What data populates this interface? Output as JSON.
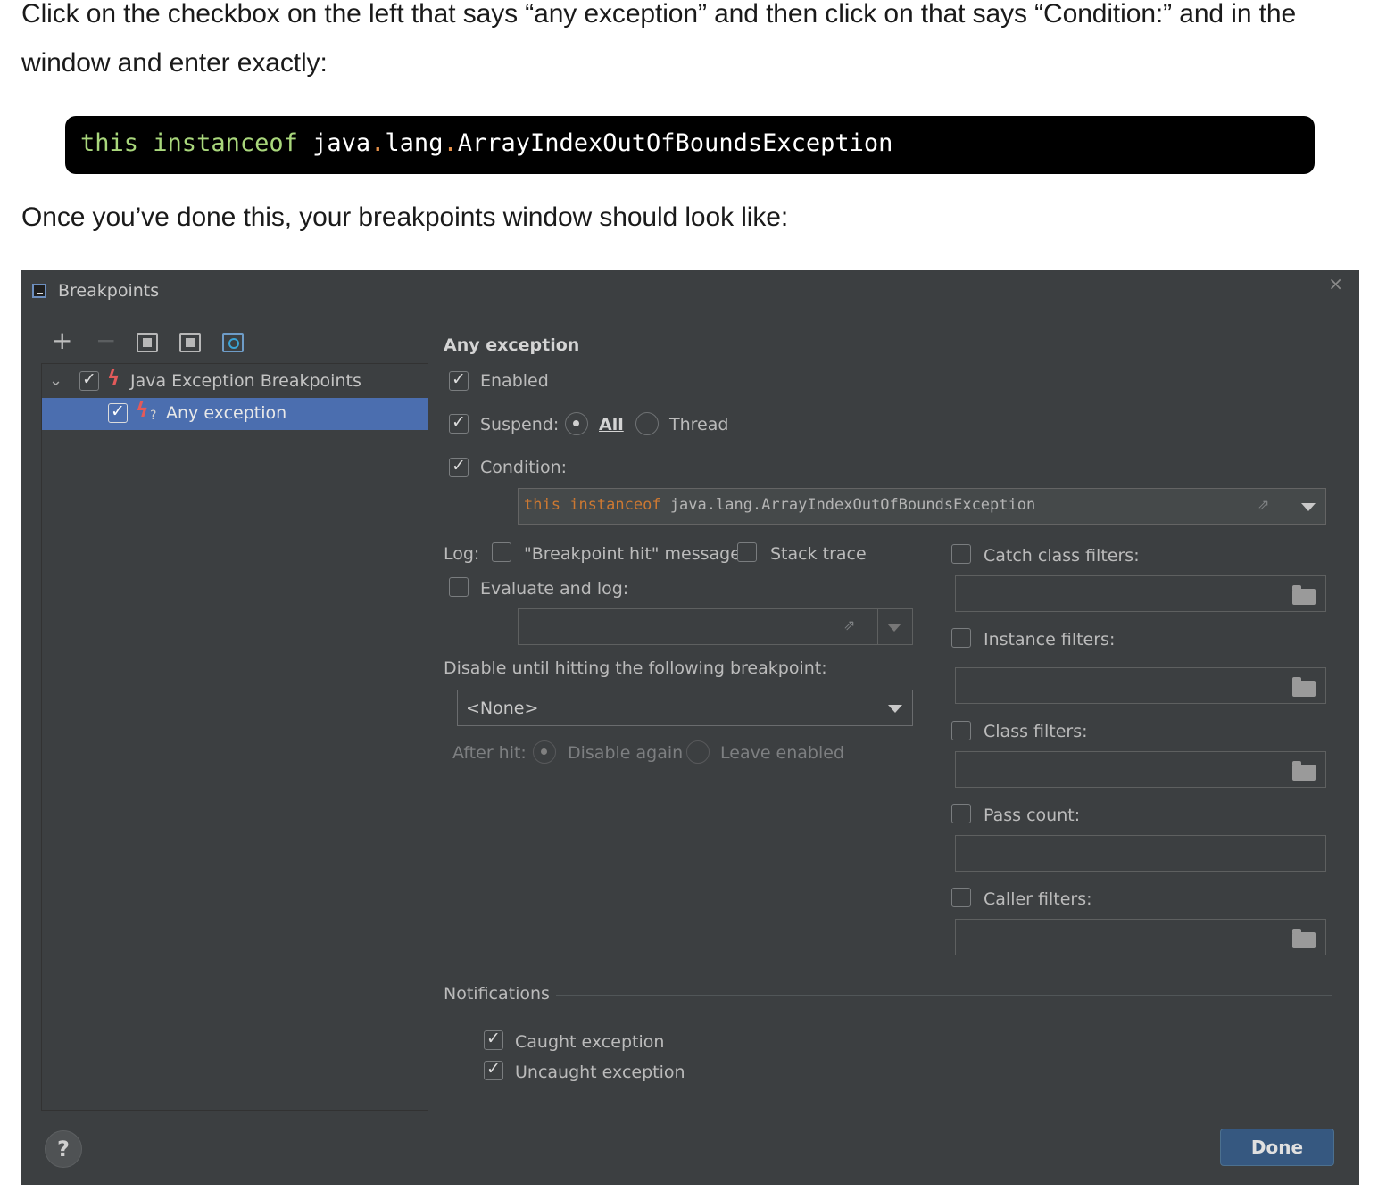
{
  "document": {
    "intro": "Click on the checkbox on the left that says “any exception” and then click on that says “Condition:” and in the window and enter exactly:",
    "code": {
      "kw_this": "this",
      "kw_instanceof": "instanceof",
      "p1": "java",
      "dot": ".",
      "p2": "lang",
      "p3": "ArrayIndexOutOfBoundsException"
    },
    "after": "Once you’ve done this, your breakpoints window should look like:"
  },
  "dialog": {
    "title": "Breakpoints",
    "close": "×",
    "toolbar": {
      "add": "+",
      "remove": "−"
    },
    "tree": {
      "group_label": "Java Exception Breakpoints",
      "item_label": "Any exception",
      "item_badge": "?"
    },
    "details": {
      "heading": "Any exception",
      "enabled": "Enabled",
      "suspend": "Suspend:",
      "all": "All",
      "thread": "Thread",
      "condition": "Condition:",
      "condition_kw1": "this",
      "condition_kw2": "instanceof",
      "condition_rest": "java.lang.ArrayIndexOutOfBoundsException",
      "log": "Log:",
      "hit_message": "\"Breakpoint hit\" message",
      "stack_trace": "Stack trace",
      "evaluate_log": "Evaluate and log:",
      "disable_until": "Disable until hitting the following breakpoint:",
      "none_option": "<None>",
      "after_hit": "After hit:",
      "disable_again": "Disable again",
      "leave_enabled": "Leave enabled",
      "catch_filters": "Catch class filters:",
      "instance_filters": "Instance filters:",
      "class_filters": "Class filters:",
      "pass_count": "Pass count:",
      "caller_filters": "Caller filters:",
      "notifications": "Notifications",
      "caught": "Caught exception",
      "uncaught": "Uncaught exception"
    },
    "help": "?",
    "done": "Done"
  }
}
